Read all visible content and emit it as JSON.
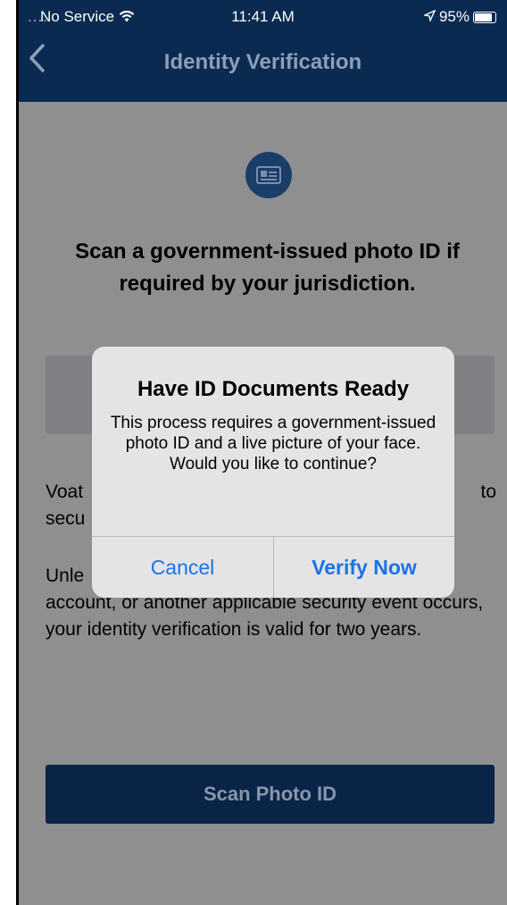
{
  "status_bar": {
    "carrier": "No Service",
    "time": "11:41 AM",
    "battery": "95%"
  },
  "nav": {
    "back_icon": "chevron-left-icon",
    "title": "Identity Verification"
  },
  "main": {
    "icon": "id-card-icon",
    "heading": "Scan a government-issued photo ID if required by your jurisdiction.",
    "para1_line1": "Voat",
    "para1_line1_end": "to",
    "para1_line2": "secu",
    "para2_line1": "Unle",
    "para2_rest": "account, or another applicable security event occurs, your identity verification is valid for two years.",
    "scan_button": "Scan Photo ID"
  },
  "alert": {
    "title": "Have ID Documents Ready",
    "message": "This process requires a government-issued photo ID and a live picture of your face. Would you like to continue?",
    "cancel_label": "Cancel",
    "confirm_label": "Verify Now"
  },
  "colors": {
    "navbar": "#0b2a52",
    "accent": "#1a73e8"
  }
}
